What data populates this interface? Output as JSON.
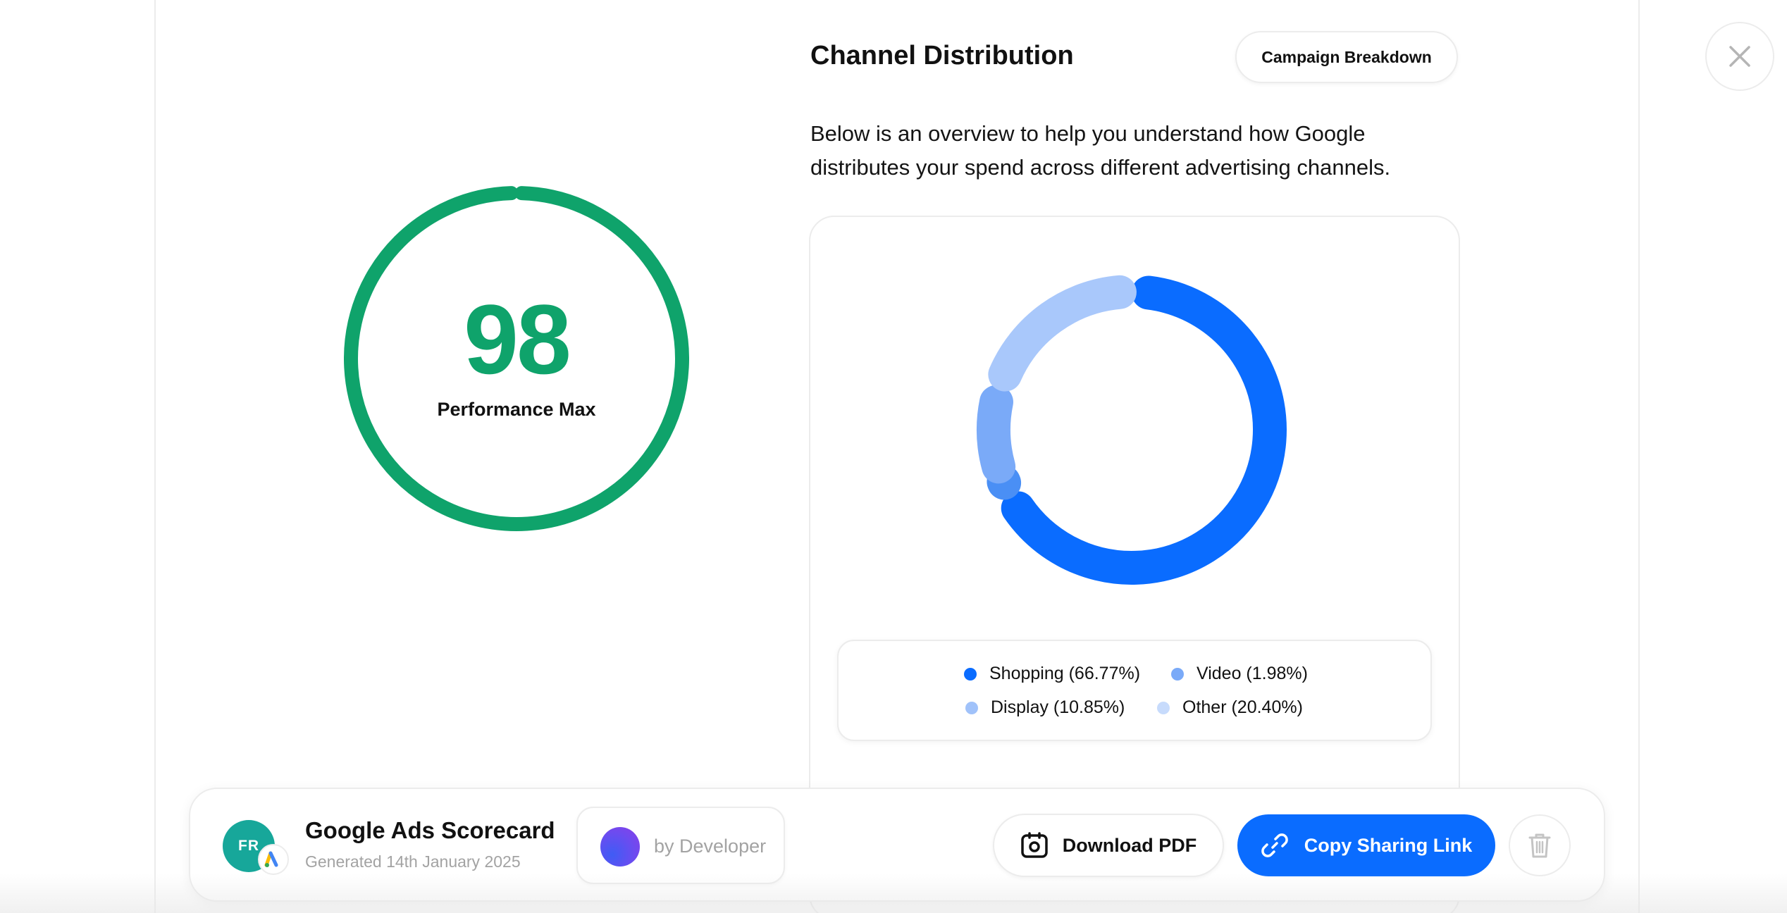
{
  "score": {
    "value": "98",
    "label": "Performance Max",
    "progress_percent": 98,
    "color": "#0fa36b"
  },
  "header": {
    "title": "Channel Distribution",
    "breakdown_button": "Campaign Breakdown",
    "close_icon": "close-icon"
  },
  "description": "Below is an overview to help you understand how Google distributes your spend across different advertising channels.",
  "chart_data": {
    "type": "pie",
    "variant": "donut",
    "title": "",
    "series": [
      {
        "name": "Shopping",
        "value": 66.77,
        "label": "Shopping (66.77%)",
        "color": "#0a6cff"
      },
      {
        "name": "Video",
        "value": 1.98,
        "label": "Video (1.98%)",
        "color": "#4a8ff5"
      },
      {
        "name": "Display",
        "value": 10.85,
        "label": "Display (10.85%)",
        "color": "#7aaaf8"
      },
      {
        "name": "Other",
        "value": 20.4,
        "label": "Other (20.40%)",
        "color": "#a9c8fb"
      }
    ],
    "legend": {
      "placement": "bottom",
      "rows": [
        [
          "Shopping (66.77%)",
          "Video (1.98%)"
        ],
        [
          "Display (10.85%)",
          "Other (20.40%)"
        ]
      ]
    }
  },
  "bottom_bar": {
    "avatar_initials": "FR",
    "badge_icon": "google-ads-icon",
    "report_title": "Google Ads Scorecard",
    "report_subtitle": "Generated 14th January 2025",
    "developer_label": "by Developer",
    "download_label": "Download PDF",
    "download_icon": "pdf-download-icon",
    "share_label": "Copy Sharing Link",
    "share_icon": "link-icon",
    "delete_icon": "trash-icon",
    "accent_color": "#0a6cff"
  }
}
